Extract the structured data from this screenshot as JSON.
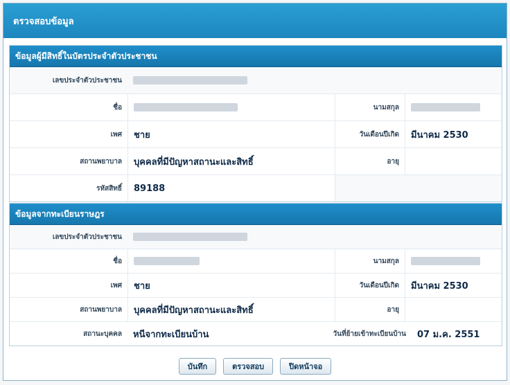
{
  "window": {
    "title": "ตรวจสอบข้อมูล"
  },
  "section1": {
    "title": "ข้อมูลผู้มีสิทธิ์ในบัตรประจำตัวประชาชน",
    "id_label": "เลขประจำตัวประชาชน",
    "name_label": "ชื่อ",
    "surname_label": "นามสกุล",
    "sex_label": "เพศ",
    "sex_value": "ชาย",
    "birth_label": "วันเดือนปีเกิด",
    "birth_value": "มีนาคม 2530",
    "hospital_label": "สถานพยาบาล",
    "hospital_value": "บุคคลที่มีปัญหาสถานะและสิทธิ์",
    "age_label": "อายุ",
    "code_label": "รหัสสิทธิ์",
    "code_value": "89188"
  },
  "section2": {
    "title": "ข้อมูลจากทะเบียนราษฎร",
    "id_label": "เลขประจำตัวประชาชน",
    "name_label": "ชื่อ",
    "surname_label": "นามสกุล",
    "sex_label": "เพศ",
    "sex_value": "ชาย",
    "birth_label": "วันเดือนปีเกิด",
    "birth_value": "มีนาคม 2530",
    "hospital_label": "สถานพยาบาล",
    "hospital_value": "บุคคลที่มีปัญหาสถานะและสิทธิ์",
    "age_label": "อายุ",
    "reg_label": "สถานะบุคคล",
    "reg_value": "หนีจากทะเบียนบ้าน",
    "date_label": "วันที่ย้ายเข้าทะเบียนบ้าน",
    "date_value": "07 ม.ค. 2551"
  },
  "buttons": {
    "save": "บันทึก",
    "verify": "ตรวจสอบ",
    "close": "ปิดหน้าจอ"
  }
}
